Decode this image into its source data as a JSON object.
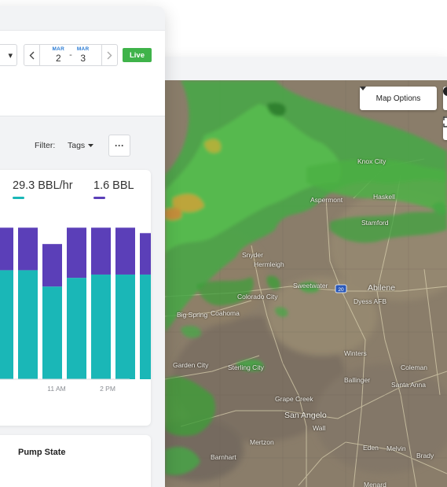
{
  "map": {
    "options_label": "Map Options",
    "labels": [
      {
        "id": "knox-city",
        "text": "Knox City"
      },
      {
        "id": "aspermont",
        "text": "Aspermont"
      },
      {
        "id": "haskell",
        "text": "Haskell"
      },
      {
        "id": "stamford",
        "text": "Stamford"
      },
      {
        "id": "snyder",
        "text": "Snyder"
      },
      {
        "id": "hermleigh",
        "text": "Hermleigh"
      },
      {
        "id": "sweetwater",
        "text": "Sweetwater"
      },
      {
        "id": "abilene",
        "text": "Abilene"
      },
      {
        "id": "dyess",
        "text": "Dyess AFB"
      },
      {
        "id": "colorado-city",
        "text": "Colorado City"
      },
      {
        "id": "big-spring",
        "text": "Big Spring"
      },
      {
        "id": "coahoma",
        "text": "Coahoma"
      },
      {
        "id": "winters",
        "text": "Winters"
      },
      {
        "id": "garden-city",
        "text": "Garden City"
      },
      {
        "id": "sterling-city",
        "text": "Sterling City"
      },
      {
        "id": "coleman",
        "text": "Coleman"
      },
      {
        "id": "ballinger",
        "text": "Ballinger"
      },
      {
        "id": "santa-anna",
        "text": "Santa Anna"
      },
      {
        "id": "grape-creek",
        "text": "Grape Creek"
      },
      {
        "id": "san-angelo",
        "text": "San Angelo"
      },
      {
        "id": "wall",
        "text": "Wall"
      },
      {
        "id": "mertzon",
        "text": "Mertzon"
      },
      {
        "id": "eden",
        "text": "Eden"
      },
      {
        "id": "melvin",
        "text": "Melvin"
      },
      {
        "id": "brady",
        "text": "Brady"
      },
      {
        "id": "barnhart",
        "text": "Barnhart"
      },
      {
        "id": "menard",
        "text": "Menard"
      }
    ],
    "highway_shield": "20",
    "colors": {
      "radar_green": "#3fae3c",
      "radar_yellow": "#c9b23a",
      "terrain": "#8a7f6d"
    }
  },
  "dashboard": {
    "period_caret": "▾",
    "date_range": {
      "start_month": "MAR",
      "start_day": "2",
      "separator": "-",
      "end_month": "MAR",
      "end_day": "3"
    },
    "live_label": "Live",
    "filter_label": "Filter:",
    "tags_label": "Tags",
    "more_label": "···",
    "metrics": [
      {
        "value": "29.3 BBL/hr",
        "color": "#1ab7b7"
      },
      {
        "value": "1.6 BBL",
        "color": "#5b3fb8"
      }
    ],
    "pump_state_title": "Pump State",
    "colors": {
      "accent_green": "#3fb34a",
      "teal": "#1ab7b7",
      "purple": "#5b3fb8"
    }
  },
  "chart_data": {
    "type": "bar",
    "stacked": true,
    "categories": [
      "",
      "",
      "",
      "",
      "",
      "",
      "",
      ""
    ],
    "x_tick_labels": [
      "11 AM",
      "2 PM"
    ],
    "series": [
      {
        "values": [
          100,
          100,
          85,
          93,
          96,
          96,
          96,
          93
        ]
      },
      {
        "values": [
          39,
          39,
          39,
          46,
          43,
          43,
          38,
          38
        ]
      }
    ],
    "ylim": [
      0,
      140
    ],
    "grid": "vertical"
  }
}
